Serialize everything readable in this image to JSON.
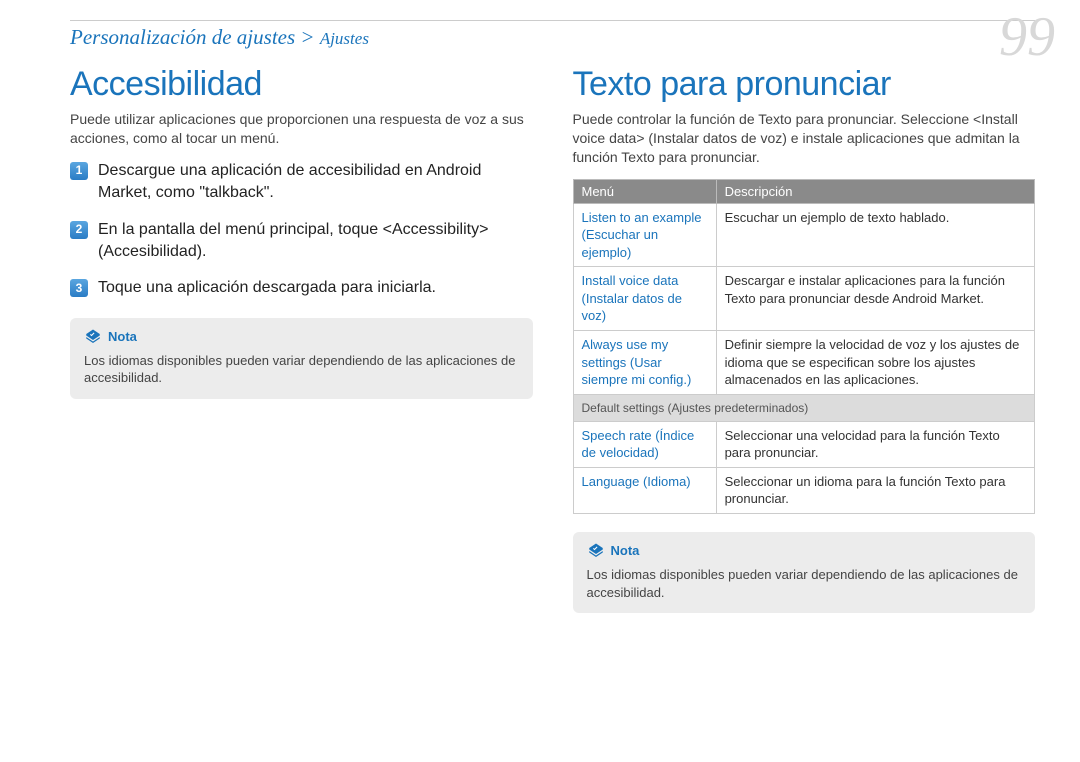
{
  "breadcrumb": {
    "main": "Personalización de ajustes",
    "sep": ">",
    "sub": "Ajustes"
  },
  "page_number": "99",
  "left": {
    "heading": "Accesibilidad",
    "intro": "Puede utilizar aplicaciones que proporcionen una respuesta de voz a sus acciones, como al tocar un menú.",
    "steps": [
      "Descargue una aplicación de accesibilidad en Android Market, como \"talkback\".",
      "En la pantalla del menú principal, toque <Accessibility> (Accesibilidad).",
      "Toque una aplicación descargada para iniciarla."
    ],
    "note_label": "Nota",
    "note_text": "Los idiomas disponibles pueden variar dependiendo de las aplicaciones de accesibilidad."
  },
  "right": {
    "heading": "Texto para pronunciar",
    "intro": "Puede controlar la función de Texto para pronunciar. Seleccione <Install voice data> (Instalar datos de voz) e instale aplicaciones que admitan la función Texto para pronunciar.",
    "table": {
      "head": {
        "c1": "Menú",
        "c2": "Descripción"
      },
      "rows": [
        {
          "menu": "Listen to an example (Escuchar un ejemplo)",
          "desc": "Escuchar un ejemplo de texto hablado."
        },
        {
          "menu": "Install voice data (Instalar datos de voz)",
          "desc": "Descargar e instalar aplicaciones para la función Texto para pronunciar desde Android Market."
        },
        {
          "menu": "Always use my settings (Usar siempre mi config.)",
          "desc": "Definir siempre la velocidad de voz y los ajustes de idioma que se especifican sobre los ajustes almacenados en las aplicaciones."
        }
      ],
      "subhead": "Default settings (Ajustes predeterminados)",
      "rows2": [
        {
          "menu": "Speech rate (Índice de velocidad)",
          "desc": "Seleccionar una velocidad para la función Texto para pronunciar."
        },
        {
          "menu": "Language (Idioma)",
          "desc": "Seleccionar un idioma para la función Texto para pronunciar."
        }
      ]
    },
    "note_label": "Nota",
    "note_text": "Los idiomas disponibles pueden variar dependiendo de las aplicaciones de accesibilidad."
  }
}
